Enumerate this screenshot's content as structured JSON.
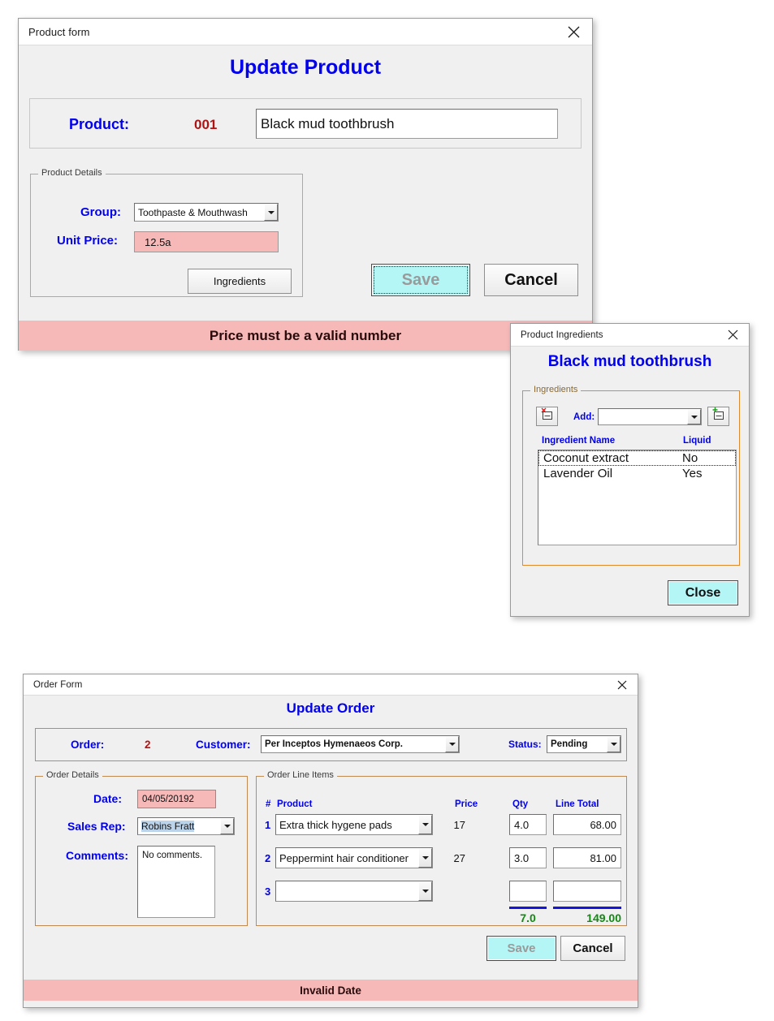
{
  "product_form": {
    "title": "Product form",
    "close_icon": "close-icon",
    "heading": "Update Product",
    "product_label": "Product:",
    "product_id": "001",
    "product_name": "Black mud toothbrush",
    "details_legend": "Product Details",
    "group_label": "Group:",
    "group_value": "Toothpaste & Mouthwash",
    "unit_price_label": "Unit Price:",
    "unit_price_value": "12.5a",
    "ingredients_button": "Ingredients",
    "save_button": "Save",
    "cancel_button": "Cancel",
    "error_message": "Price must be a valid number"
  },
  "ingredients_window": {
    "title": "Product Ingredients",
    "close_icon": "close-icon",
    "heading": "Black mud toothbrush",
    "legend": "Ingredients",
    "delete_icon": "delete-list-item-icon",
    "add_icon": "add-list-item-icon",
    "add_label": "Add:",
    "add_value": "",
    "col_name": "Ingredient Name",
    "col_liquid": "Liquid",
    "rows": [
      {
        "name": "Coconut extract",
        "liquid": "No",
        "selected": true
      },
      {
        "name": "Lavender Oil",
        "liquid": "Yes",
        "selected": false
      }
    ],
    "close_button": "Close"
  },
  "order_form": {
    "title": "Order Form",
    "close_icon": "close-icon",
    "heading": "Update Order",
    "order_label": "Order:",
    "order_id": "2",
    "customer_label": "Customer:",
    "customer_value": "Per Inceptos Hymenaeos Corp.",
    "status_label": "Status:",
    "status_value": "Pending",
    "details_legend": "Order Details",
    "date_label": "Date:",
    "date_value": "04/05/20192",
    "sales_rep_label": "Sales Rep:",
    "sales_rep_value": "Robins Fratt",
    "comments_label": "Comments:",
    "comments_value": "No comments.",
    "lines_legend": "Order Line Items",
    "col_num": "#",
    "col_product": "Product",
    "col_price": "Price",
    "col_qty": "Qty",
    "col_line_total": "Line Total",
    "lines": [
      {
        "num": "1",
        "product": "Extra thick hygene pads",
        "price": "17",
        "qty": "4.0",
        "line_total": "68.00"
      },
      {
        "num": "2",
        "product": "Peppermint hair conditioner",
        "price": "27",
        "qty": "3.0",
        "line_total": "81.00"
      },
      {
        "num": "3",
        "product": "",
        "price": "",
        "qty": "",
        "line_total": ""
      }
    ],
    "qty_total": "7.0",
    "grand_total": "149.00",
    "save_button": "Save",
    "cancel_button": "Cancel",
    "error_message": "Invalid Date"
  },
  "colors": {
    "title_blue": "#0000ee",
    "id_red": "#b11212",
    "error_pink": "#f7b8b8",
    "total_green": "#128a12",
    "accent_cyan": "#b4f5f5",
    "group_orange": "#e08a2e",
    "rule_blue": "#1414dc"
  }
}
